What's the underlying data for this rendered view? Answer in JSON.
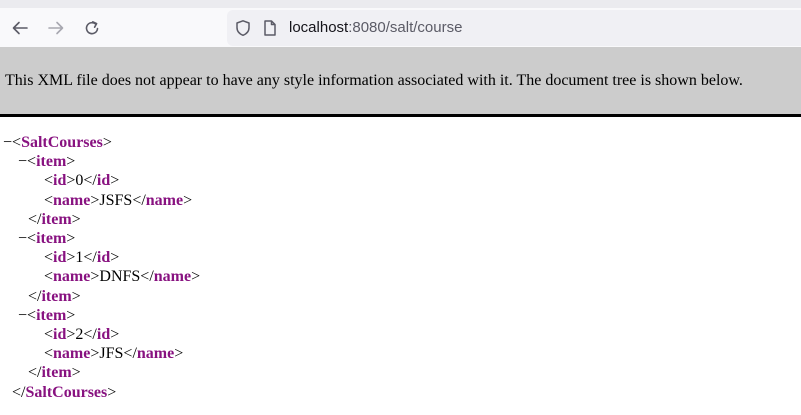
{
  "browser": {
    "url_host": "localhost",
    "url_path": ":8080/salt/course"
  },
  "xml_viewer": {
    "notice": "This XML file does not appear to have any style information associated with it. The document tree is shown below."
  },
  "xml": {
    "root_tag": "SaltCourses",
    "fold_marker": "−",
    "item_tag": "item",
    "id_tag": "id",
    "name_tag": "name",
    "items": [
      {
        "id": "0",
        "name": "JSFS"
      },
      {
        "id": "1",
        "name": "DNFS"
      },
      {
        "id": "2",
        "name": "JFS"
      }
    ]
  }
}
